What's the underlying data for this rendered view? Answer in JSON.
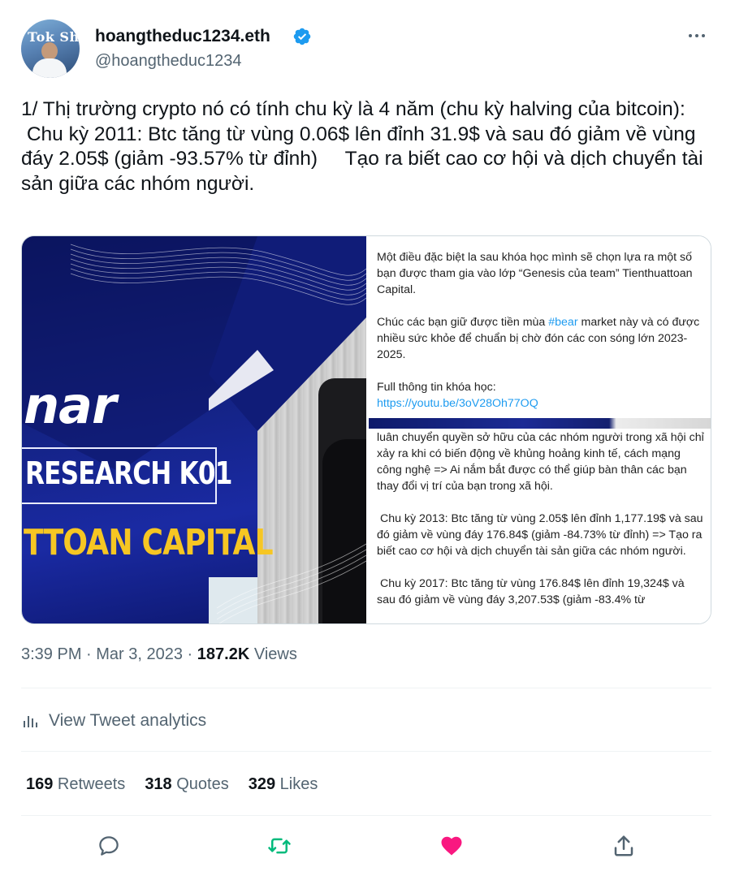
{
  "author": {
    "display_name": "hoangtheduc1234.eth",
    "handle": "@hoangtheduc1234",
    "avatar_text": "Tok Sh",
    "verified_icon": "verified-badge-icon",
    "verified_color": "#1d9bf0"
  },
  "tweet": {
    "text": "1/ Thị trường crypto nó có tính chu kỳ là 4 năm (chu kỳ halving của bitcoin):\n Chu kỳ 2011: Btc tăng từ vùng 0.06$ lên đỉnh 31.9$ và sau đó giảm về vùng đáy 2.05$ (giảm -93.57% từ đỉnh)     Tạo ra biết cao cơ hội và dịch chuyển tài sản giữa các nhóm người."
  },
  "media": {
    "left_image": {
      "text_line1": "nar",
      "text_line2": "RESEARCH K01",
      "text_line3": "TTOAN CAPITAL",
      "accent_color": "#f6c623"
    },
    "right_image": {
      "top_para1": "Một điều đặc biệt la sau khóa học mình sẽ chọn lựa ra một số bạn được tham gia vào lớp “Genesis của team” Tienthuattoan Capital.",
      "top_para2_before": "Chúc các bạn giữ được tiền mùa ",
      "top_para2_hashtag": "#bear",
      "top_para2_after": " market này và có được nhiều sức khỏe để chuẩn bị chờ đón các con sóng lớn 2023-2025.",
      "top_para3": "Full thông tin khóa học:",
      "top_link": "https://youtu.be/3oV28Oh77OQ",
      "bottom_text": "luân chuyển quyền sở hữu của các nhóm người trong xã hội chỉ xảy ra khi có biến động về khủng hoảng kinh tế, cách mạng công nghệ => Ai nắm bắt được có thể giúp bàn thân các bạn thay đổi vị trí của bạn trong xã hội.\n\n Chu kỳ 2013: Btc tăng từ vùng 2.05$ lên đỉnh 1,177.19$ và sau đó giảm về vùng đáy 176.84$ (giảm -84.73% từ đỉnh) => Tạo ra biết cao cơ hội và dịch chuyển tài sản giữa các nhóm người.\n\n Chu kỳ 2017: Btc tăng từ vùng 176.84$ lên đỉnh 19,324$ và sau đó giảm về vùng đáy 3,207.53$ (giảm -83.4% từ"
    }
  },
  "meta": {
    "time": "3:39 PM",
    "dot1": " · ",
    "date": "Mar 3, 2023",
    "dot2": " · ",
    "views_count": "187.2K",
    "views_label": " Views"
  },
  "analytics": {
    "label": "View Tweet analytics",
    "icon": "analytics-bars-icon"
  },
  "stats": {
    "retweets_count": "169",
    "retweets_label": " Retweets",
    "quotes_count": "318",
    "quotes_label": " Quotes",
    "likes_count": "329",
    "likes_label": " Likes"
  },
  "actions": {
    "reply_icon": "reply-icon",
    "retweet_icon": "retweet-icon",
    "like_icon": "heart-icon",
    "share_icon": "share-icon",
    "retweet_color": "#00ba7c",
    "like_color": "#f91880",
    "neutral_color": "#536471"
  }
}
